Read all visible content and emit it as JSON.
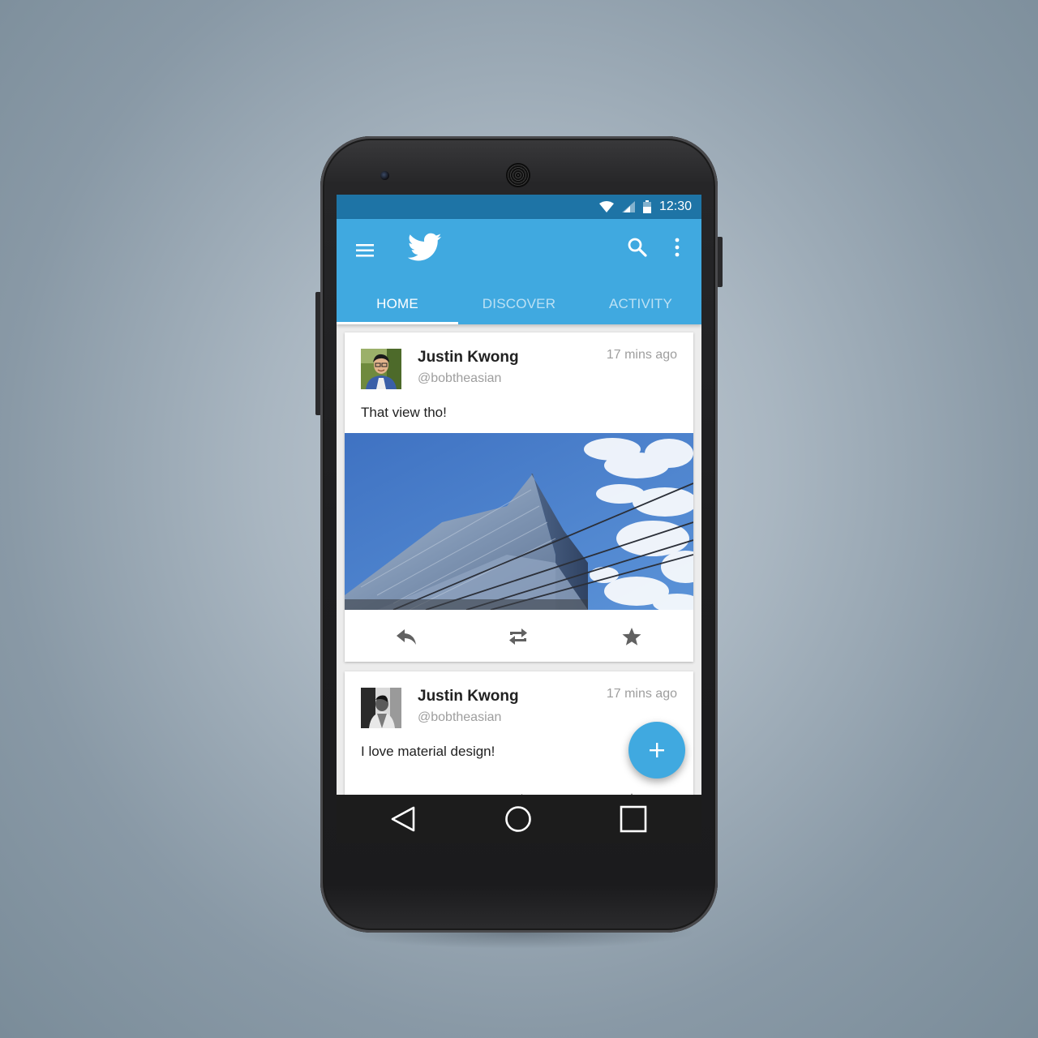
{
  "status_bar": {
    "time": "12:30",
    "icons": [
      "wifi-icon",
      "signal-icon",
      "battery-icon"
    ]
  },
  "app_bar": {
    "icons": [
      "menu-icon",
      "twitter-bird-icon",
      "search-icon",
      "overflow-menu-icon"
    ],
    "tabs": [
      {
        "label": "HOME",
        "active": true
      },
      {
        "label": "DISCOVER",
        "active": false
      },
      {
        "label": "ACTIVITY",
        "active": false
      }
    ]
  },
  "tweets": [
    {
      "name": "Justin Kwong",
      "handle": "@bobtheasian",
      "time": "17 mins ago",
      "text": "That view tho!",
      "has_photo": true
    },
    {
      "name": "Justin Kwong",
      "handle": "@bobtheasian",
      "time": "17 mins ago",
      "text": "I love material design!",
      "has_photo": false
    }
  ],
  "tweet_actions": [
    "reply-icon",
    "retweet-icon",
    "favorite-icon"
  ],
  "fab": {
    "icon": "compose-plus-icon"
  },
  "nav_bar": {
    "icons": [
      "back-icon",
      "home-icon",
      "recents-icon"
    ]
  },
  "colors": {
    "primary": "#40a9e0",
    "primary_dark": "#1e74a6",
    "card_bg": "#ffffff",
    "nav_bg": "#1c1c1c"
  }
}
